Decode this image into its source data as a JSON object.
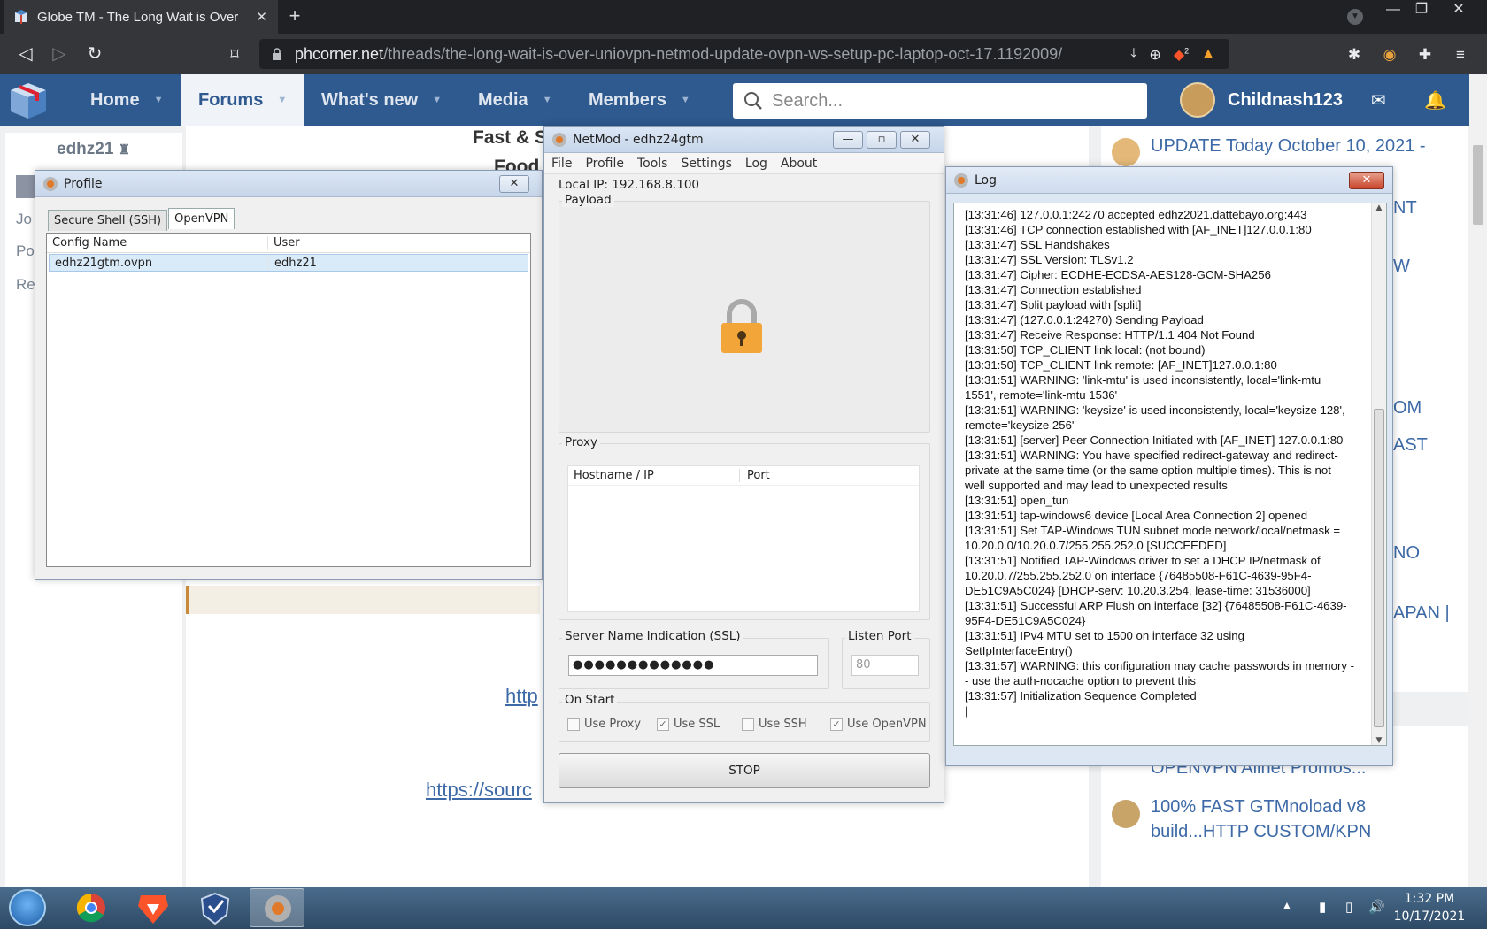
{
  "browser": {
    "tab_title": "Globe TM - The Long Wait is Over",
    "url_host": "phcorner.net",
    "url_path": "/threads/the-long-wait-is-over-uniovpn-netmod-update-ovpn-ws-setup-pc-laptop-oct-17.1192009/",
    "brave_badge": "2"
  },
  "site": {
    "nav": [
      "Home",
      "Forums",
      "What's new",
      "Media",
      "Members"
    ],
    "search_placeholder": "Search...",
    "username": "Childnash123",
    "member_name": "edhz21",
    "left_links": [
      "Jo",
      "Po",
      "Re"
    ],
    "post_title_fragment": "Fast & S",
    "post_sub_fragment": "Food",
    "link1": "http",
    "link2": "https://sourc",
    "right_fragments": [
      "UPDATE Today October 10, 2021 -",
      "NT",
      "W",
      "OM",
      "AST",
      "NO",
      "APAN |"
    ],
    "threads": [
      {
        "title": "[Oct.17.2021] HIGH-SPEED-OPENVPN Allnet Promos..."
      },
      {
        "title": "100% FAST GTMnoload v8 build...HTTP CUSTOM/KPN"
      }
    ]
  },
  "profile": {
    "title": "Profile",
    "tabs": [
      "Secure Shell (SSH)",
      "OpenVPN"
    ],
    "columns": [
      "Config Name",
      "User"
    ],
    "rows": [
      {
        "config": "edhz21gtm.ovpn",
        "user": "edhz21"
      }
    ]
  },
  "netmod": {
    "title": "NetMod - edhz24gtm",
    "menu": [
      "File",
      "Profile",
      "Tools",
      "Settings",
      "Log",
      "About"
    ],
    "local_ip": "Local IP: 192.168.8.100",
    "payload_label": "Payload",
    "proxy_label": "Proxy",
    "proxy_columns": [
      "Hostname / IP",
      "Port"
    ],
    "sni_label": "Server Name Indication (SSL)",
    "sni_value": "●●●●●●●●●●●●●",
    "listen_port_label": "Listen Port",
    "listen_port": "80",
    "on_start_label": "On Start",
    "checkboxes": [
      {
        "label": "Use Proxy",
        "checked": false
      },
      {
        "label": "Use SSL",
        "checked": true
      },
      {
        "label": "Use SSH",
        "checked": false
      },
      {
        "label": "Use OpenVPN",
        "checked": true
      }
    ],
    "stop_label": "STOP"
  },
  "log": {
    "title": "Log",
    "text": "[13:31:46] 127.0.0.1:24270 accepted edhz2021.dattebayo.org:443\n[13:31:46] TCP connection established with [AF_INET]127.0.0.1:80\n[13:31:47] SSL Handshakes\n[13:31:47] SSL Version: TLSv1.2\n[13:31:47] Cipher: ECDHE-ECDSA-AES128-GCM-SHA256\n[13:31:47] Connection established\n[13:31:47] Split payload with [split]\n[13:31:47] (127.0.0.1:24270) Sending Payload\n[13:31:47] Receive Response: HTTP/1.1 404 Not Found\n[13:31:50] TCP_CLIENT link local: (not bound)\n[13:31:50] TCP_CLIENT link remote: [AF_INET]127.0.0.1:80\n[13:31:51] WARNING: 'link-mtu' is used inconsistently, local='link-mtu 1551', remote='link-mtu 1536'\n[13:31:51] WARNING: 'keysize' is used inconsistently, local='keysize 128', remote='keysize 256'\n[13:31:51] [server] Peer Connection Initiated with [AF_INET] 127.0.0.1:80\n[13:31:51] WARNING: You have specified redirect-gateway and redirect-private at the same time (or the same option multiple times). This is not well supported and may lead to unexpected results\n[13:31:51] open_tun\n[13:31:51] tap-windows6 device [Local Area Connection 2] opened\n[13:31:51] Set TAP-Windows TUN subnet mode network/local/netmask = 10.20.0.0/10.20.0.7/255.255.252.0 [SUCCEEDED]\n[13:31:51] Notified TAP-Windows driver to set a DHCP IP/netmask of 10.20.0.7/255.255.252.0 on interface {76485508-F61C-4639-95F4-DE51C9A5C024} [DHCP-serv: 10.20.3.254, lease-time: 31536000]\n[13:31:51] Successful ARP Flush on interface [32] {76485508-F61C-4639-95F4-DE51C9A5C024}\n[13:31:51] IPv4 MTU set to 1500 on interface 32 using SetIpInterfaceEntry()\n[13:31:57] WARNING: this configuration may cache passwords in memory -- use the auth-nocache option to prevent this\n[13:31:57] Initialization Sequence Completed\n|"
  },
  "taskbar": {
    "time": "1:32 PM",
    "date": "10/17/2021"
  },
  "colors": {
    "site_nav": "#2e5a8f",
    "link": "#3d6aa7",
    "taskbar": "#2d4a66"
  }
}
